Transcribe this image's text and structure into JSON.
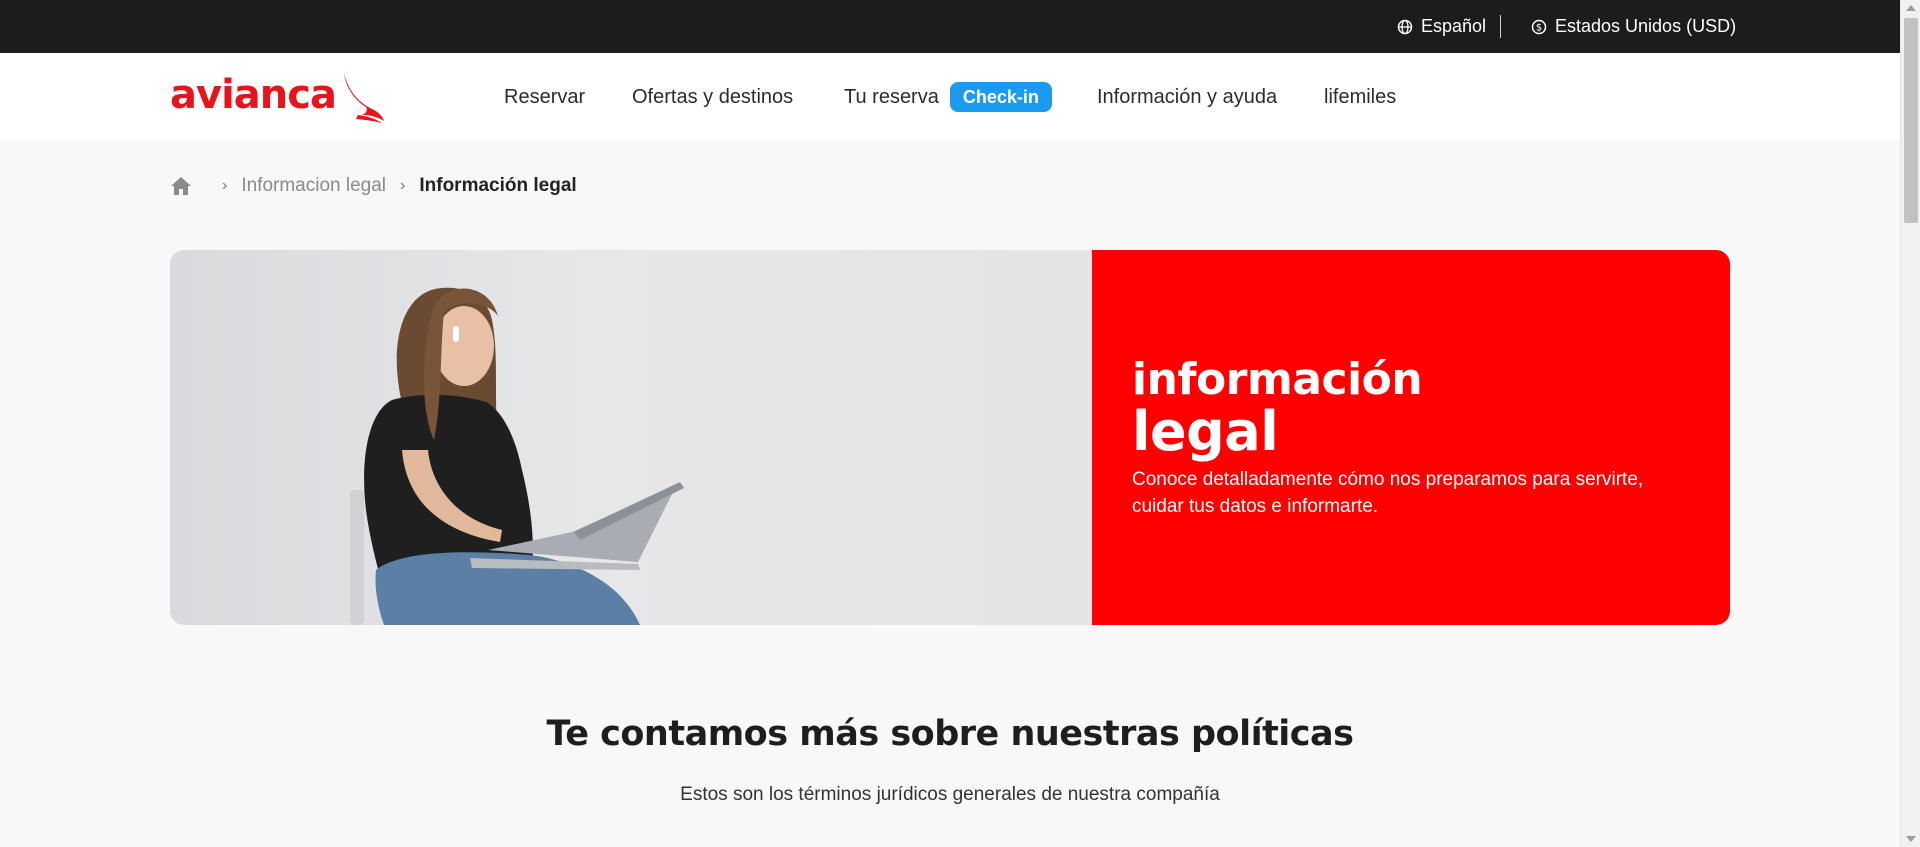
{
  "topbar": {
    "language_icon": "globe-icon",
    "language": "Español",
    "currency_icon": "dollar-circle-icon",
    "currency": "Estados Unidos (USD)"
  },
  "header": {
    "logo_text": "avianca",
    "brand_color": "#e8141b",
    "nav": {
      "reservar": "Reservar",
      "ofertas": "Ofertas y destinos",
      "tu_reserva": "Tu reserva",
      "checkin": "Check-in",
      "info": "Información y ayuda",
      "lifemiles": "lifemiles"
    },
    "checkin_color": "#1a9bf0"
  },
  "breadcrumb": {
    "home_icon": "home-icon",
    "parent": "Informacion legal",
    "current": "Información legal"
  },
  "hero": {
    "title_line1": "información",
    "title_line2": "legal",
    "description": "Conoce detalladamente cómo nos preparamos para servirte, cuidar tus datos e informarte.",
    "panel_color": "#ff0000"
  },
  "section": {
    "title": "Te contamos más sobre nuestras políticas",
    "subtitle": "Estos son los términos jurídicos generales de nuestra compañía"
  }
}
